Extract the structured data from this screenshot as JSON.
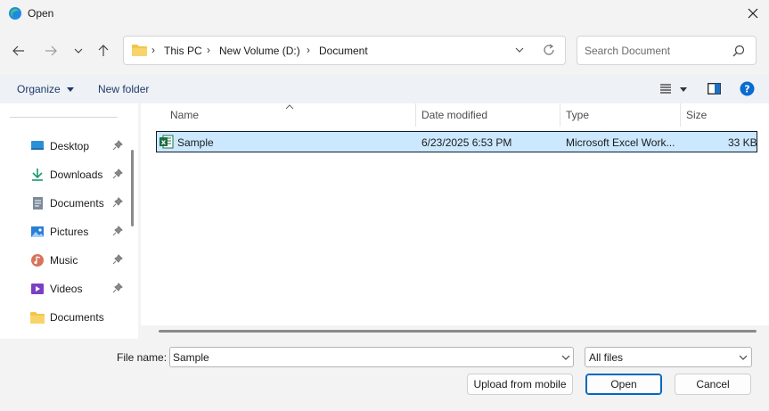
{
  "window": {
    "title": "Open"
  },
  "address": {
    "crumbs": [
      "This PC",
      "New Volume (D:)",
      "Document"
    ]
  },
  "search": {
    "placeholder": "Search Document"
  },
  "commandbar": {
    "organize": "Organize",
    "new_folder": "New folder"
  },
  "sidebar": {
    "items": [
      {
        "label": "Desktop",
        "icon": "desktop-icon",
        "pinned": true
      },
      {
        "label": "Downloads",
        "icon": "download-icon",
        "pinned": true
      },
      {
        "label": "Documents",
        "icon": "documents-icon",
        "pinned": true
      },
      {
        "label": "Pictures",
        "icon": "pictures-icon",
        "pinned": true
      },
      {
        "label": "Music",
        "icon": "music-icon",
        "pinned": true
      },
      {
        "label": "Videos",
        "icon": "videos-icon",
        "pinned": true
      },
      {
        "label": "Documents",
        "icon": "folder-icon",
        "pinned": false
      }
    ]
  },
  "filelist": {
    "columns": [
      "Name",
      "Date modified",
      "Type",
      "Size"
    ],
    "rows": [
      {
        "name": "Sample",
        "date": "6/23/2025 6:53 PM",
        "type": "Microsoft Excel Work...",
        "size": "33 KB",
        "selected": true
      }
    ]
  },
  "bottom": {
    "file_name_label": "File name:",
    "file_name_value": "Sample",
    "file_type": "All files",
    "upload_label": "Upload from mobile",
    "open_label": "Open",
    "cancel_label": "Cancel"
  },
  "colors": {
    "accent": "#0067c0",
    "selection": "#cce8ff",
    "folder": "#f2c649",
    "excel": "#1d7044"
  }
}
